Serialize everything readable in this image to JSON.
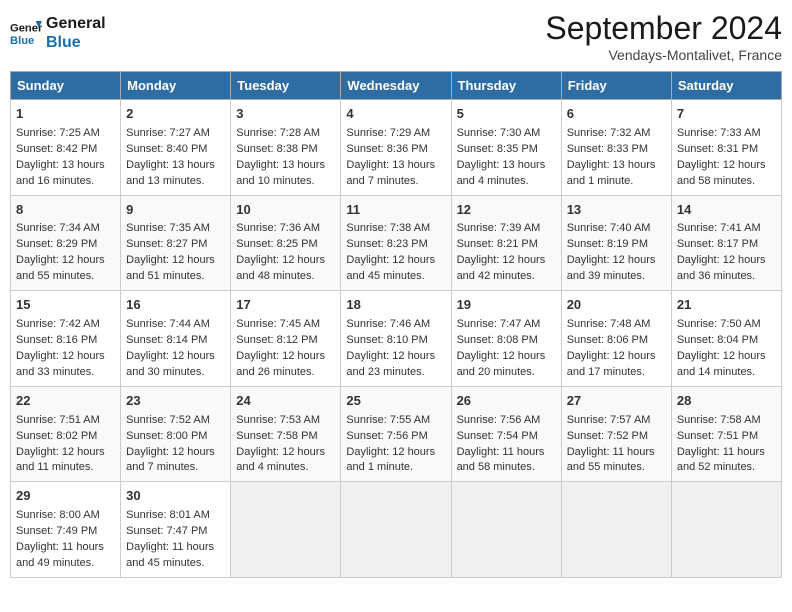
{
  "logo": {
    "line1": "General",
    "line2": "Blue"
  },
  "title": "September 2024",
  "subtitle": "Vendays-Montalivet, France",
  "days_of_week": [
    "Sunday",
    "Monday",
    "Tuesday",
    "Wednesday",
    "Thursday",
    "Friday",
    "Saturday"
  ],
  "weeks": [
    [
      {
        "day": "1",
        "lines": [
          "Sunrise: 7:25 AM",
          "Sunset: 8:42 PM",
          "Daylight: 13 hours",
          "and 16 minutes."
        ]
      },
      {
        "day": "2",
        "lines": [
          "Sunrise: 7:27 AM",
          "Sunset: 8:40 PM",
          "Daylight: 13 hours",
          "and 13 minutes."
        ]
      },
      {
        "day": "3",
        "lines": [
          "Sunrise: 7:28 AM",
          "Sunset: 8:38 PM",
          "Daylight: 13 hours",
          "and 10 minutes."
        ]
      },
      {
        "day": "4",
        "lines": [
          "Sunrise: 7:29 AM",
          "Sunset: 8:36 PM",
          "Daylight: 13 hours",
          "and 7 minutes."
        ]
      },
      {
        "day": "5",
        "lines": [
          "Sunrise: 7:30 AM",
          "Sunset: 8:35 PM",
          "Daylight: 13 hours",
          "and 4 minutes."
        ]
      },
      {
        "day": "6",
        "lines": [
          "Sunrise: 7:32 AM",
          "Sunset: 8:33 PM",
          "Daylight: 13 hours",
          "and 1 minute."
        ]
      },
      {
        "day": "7",
        "lines": [
          "Sunrise: 7:33 AM",
          "Sunset: 8:31 PM",
          "Daylight: 12 hours",
          "and 58 minutes."
        ]
      }
    ],
    [
      {
        "day": "8",
        "lines": [
          "Sunrise: 7:34 AM",
          "Sunset: 8:29 PM",
          "Daylight: 12 hours",
          "and 55 minutes."
        ]
      },
      {
        "day": "9",
        "lines": [
          "Sunrise: 7:35 AM",
          "Sunset: 8:27 PM",
          "Daylight: 12 hours",
          "and 51 minutes."
        ]
      },
      {
        "day": "10",
        "lines": [
          "Sunrise: 7:36 AM",
          "Sunset: 8:25 PM",
          "Daylight: 12 hours",
          "and 48 minutes."
        ]
      },
      {
        "day": "11",
        "lines": [
          "Sunrise: 7:38 AM",
          "Sunset: 8:23 PM",
          "Daylight: 12 hours",
          "and 45 minutes."
        ]
      },
      {
        "day": "12",
        "lines": [
          "Sunrise: 7:39 AM",
          "Sunset: 8:21 PM",
          "Daylight: 12 hours",
          "and 42 minutes."
        ]
      },
      {
        "day": "13",
        "lines": [
          "Sunrise: 7:40 AM",
          "Sunset: 8:19 PM",
          "Daylight: 12 hours",
          "and 39 minutes."
        ]
      },
      {
        "day": "14",
        "lines": [
          "Sunrise: 7:41 AM",
          "Sunset: 8:17 PM",
          "Daylight: 12 hours",
          "and 36 minutes."
        ]
      }
    ],
    [
      {
        "day": "15",
        "lines": [
          "Sunrise: 7:42 AM",
          "Sunset: 8:16 PM",
          "Daylight: 12 hours",
          "and 33 minutes."
        ]
      },
      {
        "day": "16",
        "lines": [
          "Sunrise: 7:44 AM",
          "Sunset: 8:14 PM",
          "Daylight: 12 hours",
          "and 30 minutes."
        ]
      },
      {
        "day": "17",
        "lines": [
          "Sunrise: 7:45 AM",
          "Sunset: 8:12 PM",
          "Daylight: 12 hours",
          "and 26 minutes."
        ]
      },
      {
        "day": "18",
        "lines": [
          "Sunrise: 7:46 AM",
          "Sunset: 8:10 PM",
          "Daylight: 12 hours",
          "and 23 minutes."
        ]
      },
      {
        "day": "19",
        "lines": [
          "Sunrise: 7:47 AM",
          "Sunset: 8:08 PM",
          "Daylight: 12 hours",
          "and 20 minutes."
        ]
      },
      {
        "day": "20",
        "lines": [
          "Sunrise: 7:48 AM",
          "Sunset: 8:06 PM",
          "Daylight: 12 hours",
          "and 17 minutes."
        ]
      },
      {
        "day": "21",
        "lines": [
          "Sunrise: 7:50 AM",
          "Sunset: 8:04 PM",
          "Daylight: 12 hours",
          "and 14 minutes."
        ]
      }
    ],
    [
      {
        "day": "22",
        "lines": [
          "Sunrise: 7:51 AM",
          "Sunset: 8:02 PM",
          "Daylight: 12 hours",
          "and 11 minutes."
        ]
      },
      {
        "day": "23",
        "lines": [
          "Sunrise: 7:52 AM",
          "Sunset: 8:00 PM",
          "Daylight: 12 hours",
          "and 7 minutes."
        ]
      },
      {
        "day": "24",
        "lines": [
          "Sunrise: 7:53 AM",
          "Sunset: 7:58 PM",
          "Daylight: 12 hours",
          "and 4 minutes."
        ]
      },
      {
        "day": "25",
        "lines": [
          "Sunrise: 7:55 AM",
          "Sunset: 7:56 PM",
          "Daylight: 12 hours",
          "and 1 minute."
        ]
      },
      {
        "day": "26",
        "lines": [
          "Sunrise: 7:56 AM",
          "Sunset: 7:54 PM",
          "Daylight: 11 hours",
          "and 58 minutes."
        ]
      },
      {
        "day": "27",
        "lines": [
          "Sunrise: 7:57 AM",
          "Sunset: 7:52 PM",
          "Daylight: 11 hours",
          "and 55 minutes."
        ]
      },
      {
        "day": "28",
        "lines": [
          "Sunrise: 7:58 AM",
          "Sunset: 7:51 PM",
          "Daylight: 11 hours",
          "and 52 minutes."
        ]
      }
    ],
    [
      {
        "day": "29",
        "lines": [
          "Sunrise: 8:00 AM",
          "Sunset: 7:49 PM",
          "Daylight: 11 hours",
          "and 49 minutes."
        ]
      },
      {
        "day": "30",
        "lines": [
          "Sunrise: 8:01 AM",
          "Sunset: 7:47 PM",
          "Daylight: 11 hours",
          "and 45 minutes."
        ]
      },
      {
        "day": "",
        "lines": []
      },
      {
        "day": "",
        "lines": []
      },
      {
        "day": "",
        "lines": []
      },
      {
        "day": "",
        "lines": []
      },
      {
        "day": "",
        "lines": []
      }
    ]
  ]
}
